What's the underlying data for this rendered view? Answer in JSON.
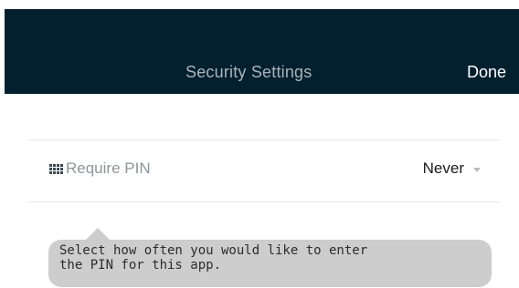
{
  "header": {
    "title": "Security Settings",
    "done_label": "Done"
  },
  "setting": {
    "icon": "grid-icon",
    "label": "Require PIN",
    "value": "Never"
  },
  "tooltip": {
    "line1": "Select how often you would like to enter",
    "line2": "the PIN for this app."
  },
  "colors": {
    "navbar": "#04202f",
    "title": "#a9b4ba",
    "tooltip_bg": "#cdcdcd"
  }
}
